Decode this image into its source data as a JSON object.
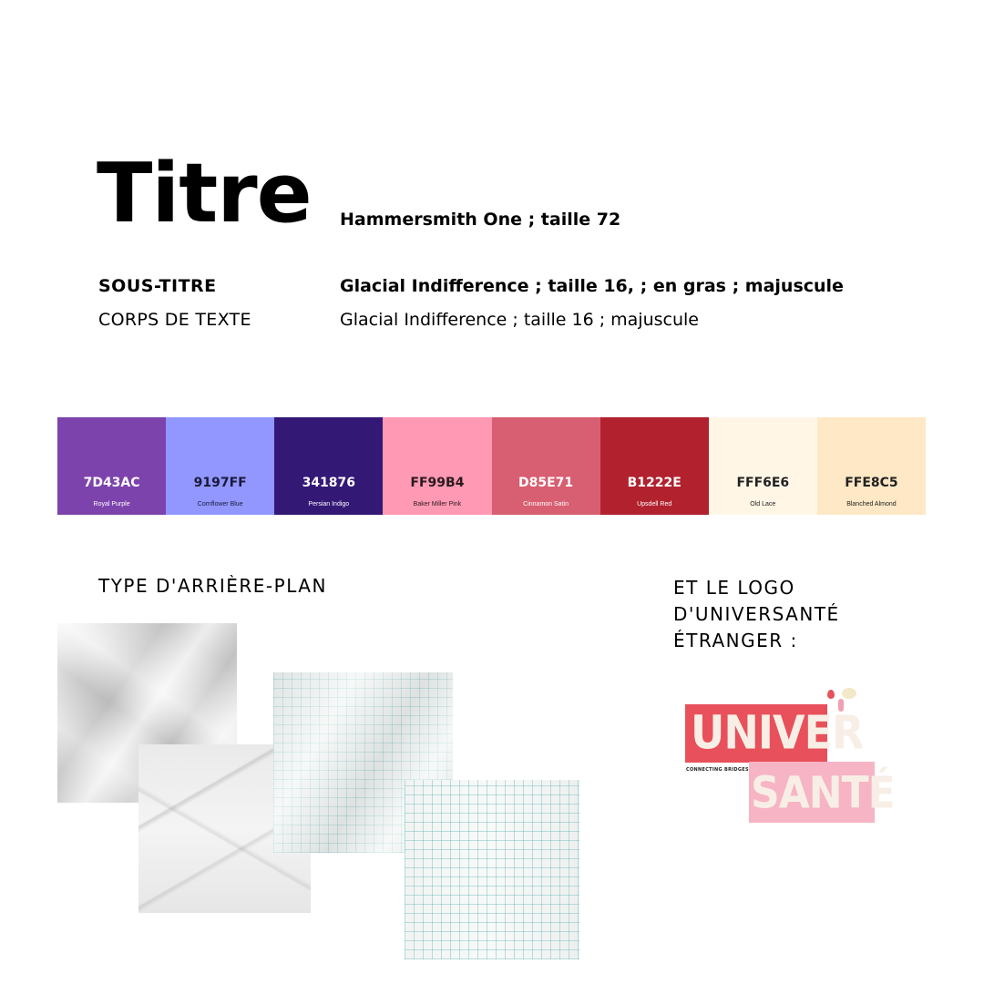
{
  "typography": {
    "title": "Titre",
    "title_spec": "Hammersmith One ; taille 72",
    "subtitle": "SOUS-TITRE",
    "subtitle_spec": "Glacial Indifference ; taille 16, ; en gras ; majuscule",
    "body_label": "CORPS DE TEXTE",
    "body_spec": "Glacial Indifference ; taille 16 ; majuscule"
  },
  "palette": [
    {
      "hex": "7D43AC",
      "name": "Royal Purple",
      "color": "#7d43ac",
      "text_color": "#ffffff"
    },
    {
      "hex": "9197FF",
      "name": "Cornflower Blue",
      "color": "#9197ff",
      "text_color": "#1a1a3a"
    },
    {
      "hex": "341876",
      "name": "Persian Indigo",
      "color": "#341876",
      "text_color": "#ffffff"
    },
    {
      "hex": "FF99B4",
      "name": "Baker Miller Pink",
      "color": "#ff99b4",
      "text_color": "#2a1a1f"
    },
    {
      "hex": "D85E71",
      "name": "Cinnamon Satin",
      "color": "#d85e71",
      "text_color": "#ffffff"
    },
    {
      "hex": "B1222E",
      "name": "Upsdell Red",
      "color": "#b1222e",
      "text_color": "#ffffff"
    },
    {
      "hex": "FFF6E6",
      "name": "Old Lace",
      "color": "#fff6e6",
      "text_color": "#222222"
    },
    {
      "hex": "FFE8C5",
      "name": "Blanched Almond",
      "color": "#ffe8c5",
      "text_color": "#222222"
    }
  ],
  "background_section": {
    "heading": "TYPE D'ARRIÈRE-PLAN"
  },
  "logo_section": {
    "heading_lines": [
      "ET LE LOGO",
      "D'UNIVERSANTÉ",
      "ÉTRANGER :"
    ],
    "logo_word1": "UNIVER",
    "logo_word2": "SANTÉ",
    "logo_tagline": "CONNECTING BRIDGES!"
  }
}
